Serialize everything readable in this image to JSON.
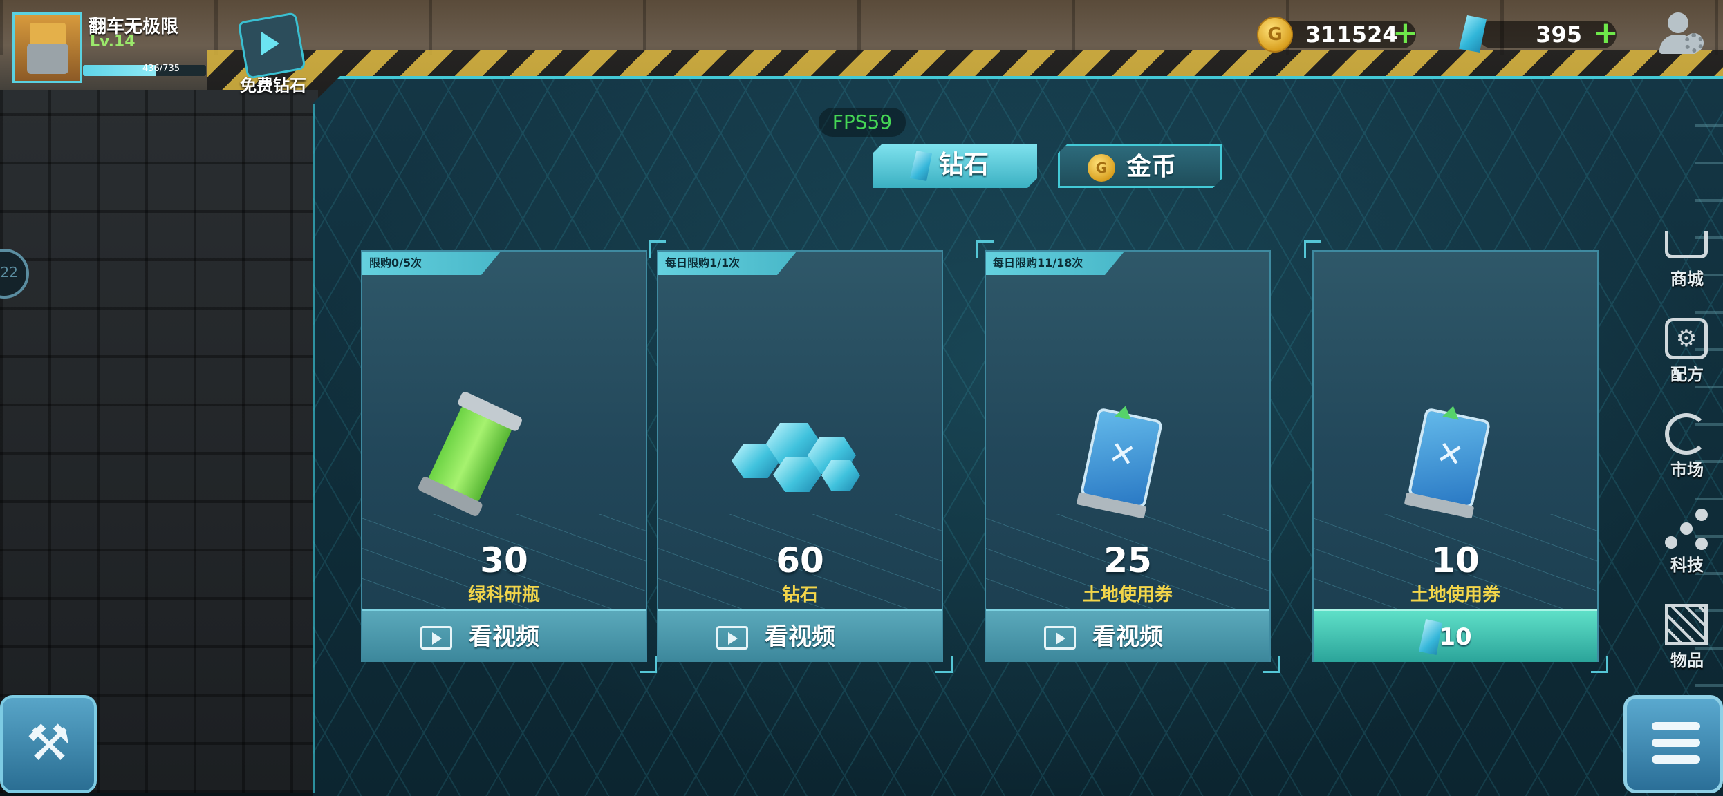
{
  "player": {
    "name": "翻车无极限",
    "level": "Lv.14",
    "xp_text": "436/735",
    "xp_progress": 0.593
  },
  "free_diamond": {
    "label": "免费钻石",
    "icon": "video-clapper-icon"
  },
  "currency": {
    "gold": {
      "value": "311524",
      "icon": "gold-coin-icon",
      "coin_letter": "G"
    },
    "diamond": {
      "value": "395",
      "icon": "diamond-icon"
    },
    "plus": "+"
  },
  "fps": "FPS59",
  "tabs": [
    {
      "label": "钻石",
      "icon": "diamond-icon",
      "active": true
    },
    {
      "label": "金币",
      "icon": "gold-coin-icon",
      "coin_letter": "G",
      "active": false
    }
  ],
  "offers": [
    {
      "limit": "限购0/5次",
      "count": "30",
      "name": "绿科研瓶",
      "button": "看视频",
      "price_type": "video",
      "item_icon": "green-research-bottle-icon"
    },
    {
      "limit": "每日限购1/1次",
      "count": "60",
      "name": "钻石",
      "button": "看视频",
      "price_type": "video",
      "item_icon": "diamond-pile-icon"
    },
    {
      "limit": "每日限购11/18次",
      "count": "25",
      "name": "土地使用券",
      "button": "看视频",
      "price_type": "video",
      "item_icon": "land-ticket-icon"
    },
    {
      "limit": "",
      "count": "10",
      "name": "土地使用券",
      "button": "10",
      "price_type": "diamond",
      "item_icon": "land-ticket-icon"
    }
  ],
  "sidebar": [
    {
      "label": "商城",
      "icon": "cart-icon"
    },
    {
      "label": "配方",
      "icon": "recipe-chip-icon"
    },
    {
      "label": "市场",
      "icon": "market-icon"
    },
    {
      "label": "科技",
      "icon": "tech-nodes-icon"
    },
    {
      "label": "物品",
      "icon": "crate-icon"
    }
  ],
  "left_ring_text": "22",
  "colors": {
    "accent": "#43c9d6",
    "count_label": "#f2d54a",
    "plus": "#6ee84a",
    "fps": "#45d655"
  }
}
